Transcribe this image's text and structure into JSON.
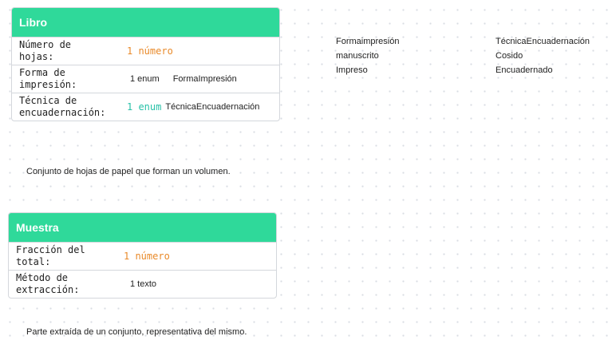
{
  "libro": {
    "title": "Libro",
    "attributes": [
      {
        "name": "Número de\nhojas:",
        "cardinality": "1 número",
        "type": ""
      },
      {
        "name": "Forma de\nimpresión:",
        "cardinality": "1 enum",
        "type": "FormaImpresión"
      },
      {
        "name": "Técnica de\nencuadernación:",
        "cardinality": "1 enum",
        "type": "TécnicaEncuadernación"
      }
    ],
    "description": "Conjunto de hojas de papel que forman un volumen."
  },
  "muestra": {
    "title": "Muestra",
    "attributes": [
      {
        "name": "Fracción del\ntotal:",
        "cardinality": "1 número",
        "type": ""
      },
      {
        "name": "Método de\nextracción:",
        "cardinality": "1 texto",
        "type": ""
      }
    ],
    "description": "Parte extraída de un conjunto, representativa del mismo."
  },
  "enums": [
    {
      "title": "Formaimpresión",
      "values": [
        "manuscrito",
        "Impreso"
      ]
    },
    {
      "title": "TécnicaEncuadernación",
      "values": [
        "Cosido",
        "Encuadernado"
      ]
    }
  ],
  "colors": {
    "header": "#2fd99a",
    "number": "#e98a2a",
    "enum": "#28c1a8"
  }
}
